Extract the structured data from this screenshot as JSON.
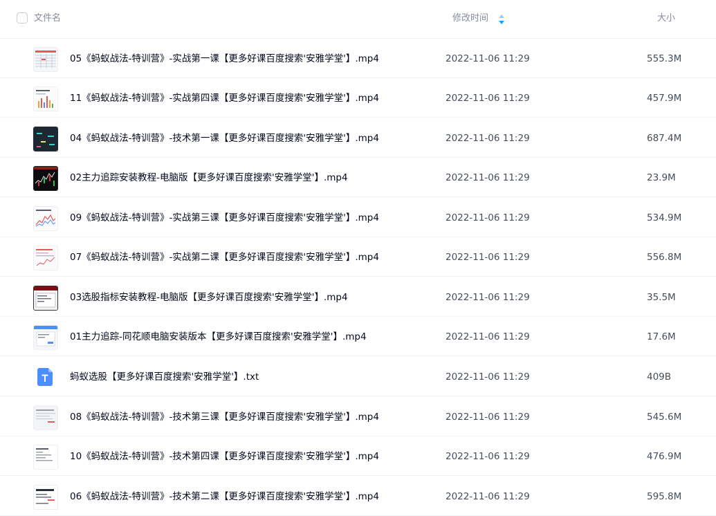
{
  "header": {
    "name_label": "文件名",
    "time_label": "修改时间",
    "size_label": "大小"
  },
  "files": [
    {
      "name": "05《蚂蚁战法-特训营》-实战第一课【更多好课百度搜索'安雅学堂'】.mp4",
      "time": "2022-11-06 11:29",
      "size": "555.3M",
      "icon": "video-thumbnail-table"
    },
    {
      "name": "11《蚂蚁战法-特训营》-实战第四课【更多好课百度搜索'安雅学堂'】.mp4",
      "time": "2022-11-06 11:29",
      "size": "457.9M",
      "icon": "video-thumbnail-chart"
    },
    {
      "name": "04《蚂蚁战法-特训营》-技术第一课【更多好课百度搜索'安雅学堂'】.mp4",
      "time": "2022-11-06 11:29",
      "size": "687.4M",
      "icon": "video-thumbnail-dark"
    },
    {
      "name": "02主力追踪安装教程-电脑版【更多好课百度搜索'安雅学堂'】.mp4",
      "time": "2022-11-06 11:29",
      "size": "23.9M",
      "icon": "video-thumbnail-stock"
    },
    {
      "name": "09《蚂蚁战法-特训营》-实战第三课【更多好课百度搜索'安雅学堂'】.mp4",
      "time": "2022-11-06 11:29",
      "size": "534.9M",
      "icon": "video-thumbnail-chart"
    },
    {
      "name": "07《蚂蚁战法-特训营》-实战第二课【更多好课百度搜索'安雅学堂'】.mp4",
      "time": "2022-11-06 11:29",
      "size": "556.8M",
      "icon": "video-thumbnail-doc"
    },
    {
      "name": "03选股指标安装教程-电脑版【更多好课百度搜索'安雅学堂'】.mp4",
      "time": "2022-11-06 11:29",
      "size": "35.5M",
      "icon": "video-thumbnail-window"
    },
    {
      "name": "01主力追踪-同花顺电脑安装版本【更多好课百度搜索'安雅学堂'】.mp4",
      "time": "2022-11-06 11:29",
      "size": "17.6M",
      "icon": "video-thumbnail-window"
    },
    {
      "name": "蚂蚁选股【更多好课百度搜索'安雅学堂'】.txt",
      "time": "2022-11-06 11:29",
      "size": "409B",
      "icon": "txt-file-icon"
    },
    {
      "name": "08《蚂蚁战法-特训营》-技术第三课【更多好课百度搜索'安雅学堂'】.mp4",
      "time": "2022-11-06 11:29",
      "size": "545.6M",
      "icon": "video-thumbnail-doc"
    },
    {
      "name": "10《蚂蚁战法-特训营》-技术第四课【更多好课百度搜索'安雅学堂'】.mp4",
      "time": "2022-11-06 11:29",
      "size": "476.9M",
      "icon": "video-thumbnail-doc"
    },
    {
      "name": "06《蚂蚁战法-特训营》-技术第二课【更多好课百度搜索'安雅学堂'】.mp4",
      "time": "2022-11-06 11:29",
      "size": "595.8M",
      "icon": "video-thumbnail-doc"
    }
  ],
  "colors": {
    "accent": "#06a7ff",
    "txt_icon": "#4c8dff"
  }
}
